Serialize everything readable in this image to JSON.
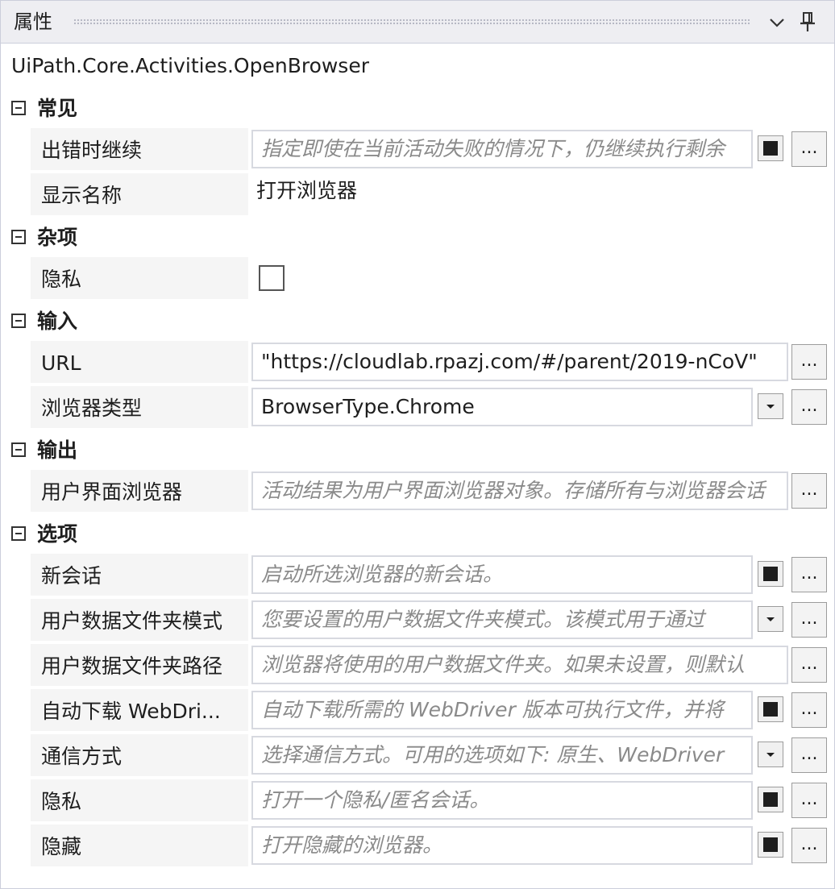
{
  "panel": {
    "title": "属性",
    "class_name": "UiPath.Core.Activities.OpenBrowser"
  },
  "icons": {
    "collapse": "chevron-down-icon",
    "pin": "pin-icon",
    "category_toggle": "collapse-minus-icon",
    "more": "ellipsis-button-icon",
    "dropdown": "dropdown-arrow-icon"
  },
  "ellipsis_label": "...",
  "categories": [
    {
      "label": "常见",
      "rows": [
        {
          "name": "出错时继续",
          "value": "指定即使在当前活动失败的情况下，仍继续执行剩余",
          "hint": true
        },
        {
          "name": "显示名称",
          "value": "打开浏览器",
          "hint": false
        }
      ]
    },
    {
      "label": "杂项",
      "rows": [
        {
          "name": "隐私",
          "checked": false
        }
      ]
    },
    {
      "label": "输入",
      "rows": [
        {
          "name": "URL",
          "value": "\"https://cloudlab.rpazj.com/#/parent/2019-nCoV\"",
          "hint": false
        },
        {
          "name": "浏览器类型",
          "value": "BrowserType.Chrome",
          "hint": false
        }
      ]
    },
    {
      "label": "输出",
      "rows": [
        {
          "name": "用户界面浏览器",
          "value": "活动结果为用户界面浏览器对象。存储所有与浏览器会话",
          "hint": true
        }
      ]
    },
    {
      "label": "选项",
      "rows": [
        {
          "name": "新会话",
          "value": "启动所选浏览器的新会话。",
          "hint": true
        },
        {
          "name": "用户数据文件夹模式",
          "value": "您要设置的用户数据文件夹模式。该模式用于通过",
          "hint": true
        },
        {
          "name": "用户数据文件夹路径",
          "value": "浏览器将使用的用户数据文件夹。如果未设置，则默认",
          "hint": true
        },
        {
          "name": "自动下载 WebDri...",
          "value": "自动下载所需的 WebDriver 版本可执行文件，并将",
          "hint": true
        },
        {
          "name": "通信方式",
          "value": "选择通信方式。可用的选项如下: 原生、WebDriver",
          "hint": true
        },
        {
          "name": "隐私",
          "value": "打开一个隐私/匿名会话。",
          "hint": true
        },
        {
          "name": "隐藏",
          "value": "打开隐藏的浏览器。",
          "hint": true
        }
      ]
    }
  ]
}
